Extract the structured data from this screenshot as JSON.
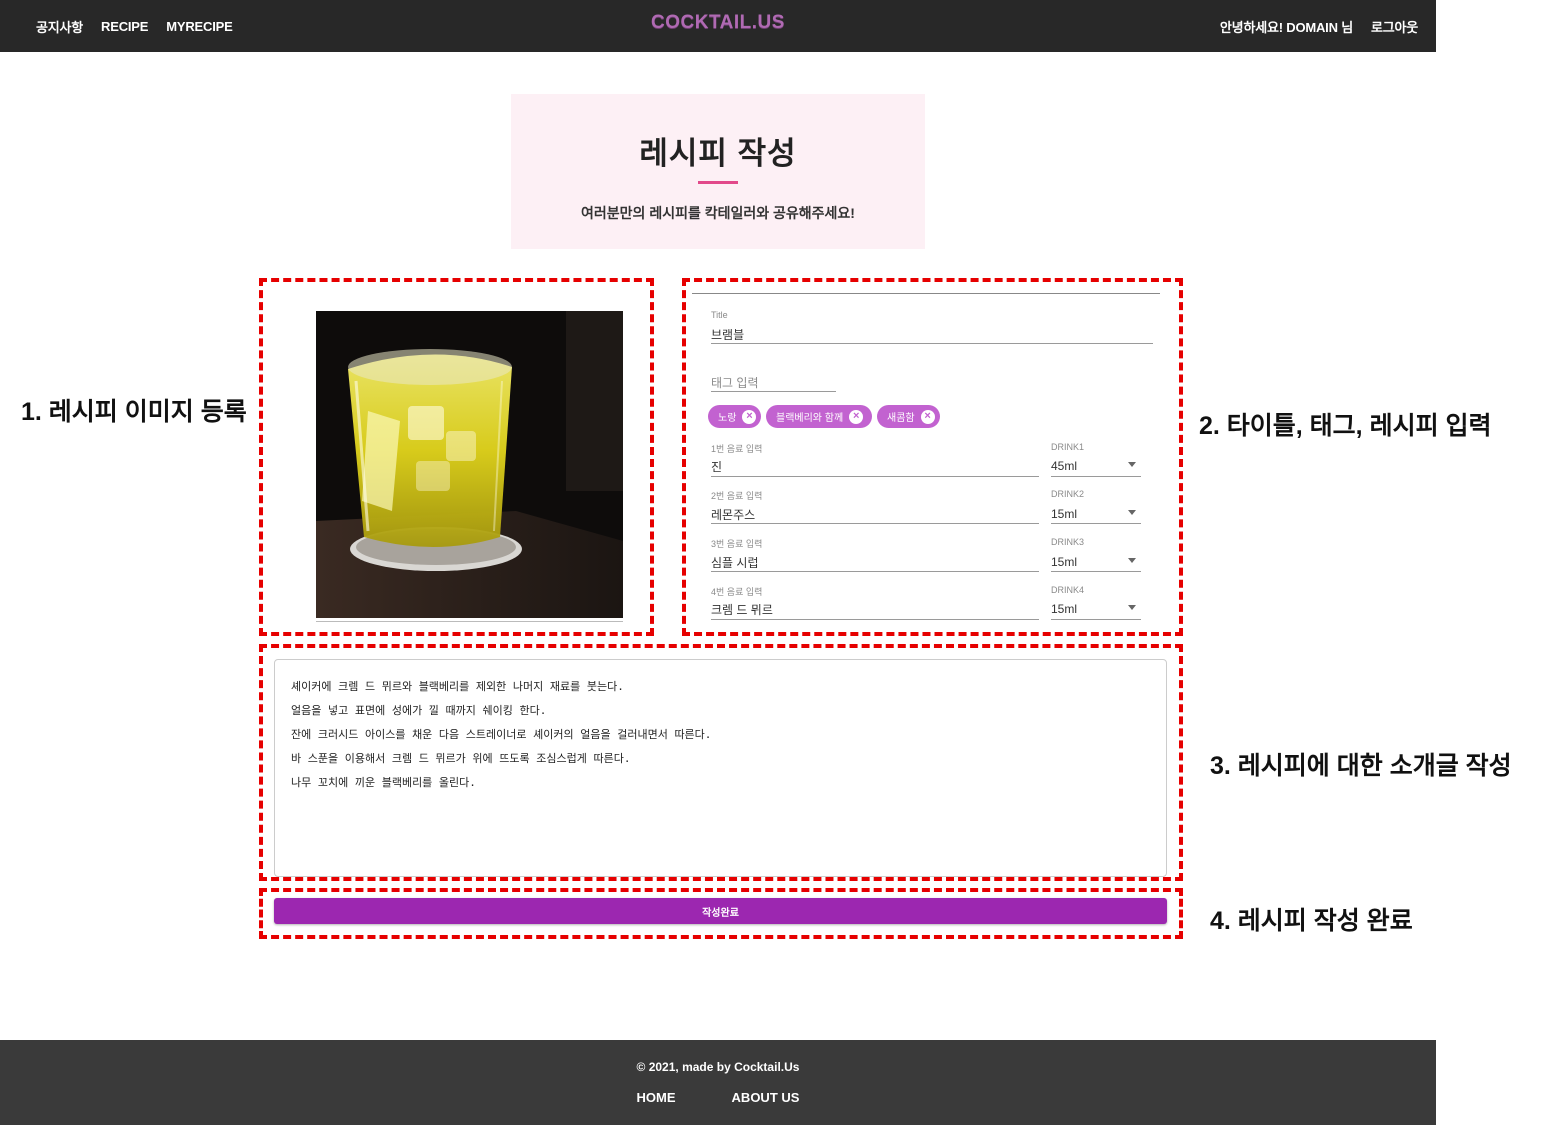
{
  "nav": {
    "notice": "공지사항",
    "recipe": "RECIPE",
    "myrecipe": "MYRECIPE",
    "logo": "COCKTAIL.US",
    "greeting": "안녕하세요! DOMAIN 님",
    "logout": "로그아웃"
  },
  "hero": {
    "title": "레시피 작성",
    "subtitle": "여러분만의 레시피를 칵테일러와 공유해주세요!"
  },
  "annotations": {
    "a1": "1. 레시피 이미지 등록",
    "a2": "2. 타이틀, 태그, 레시피 입력",
    "a3": "3. 레시피에 대한 소개글 작성",
    "a4": "4. 레시피 작성 완료"
  },
  "form": {
    "title_label": "Title",
    "title_value": "브램블",
    "tag_placeholder": "태그 입력",
    "tags": [
      "노랑",
      "블랙베리와 함께",
      "새콤함"
    ],
    "drinks": [
      {
        "name_label": "1번 음료 입력",
        "name_value": "진",
        "amount_label": "DRINK1",
        "amount_value": "45ml"
      },
      {
        "name_label": "2번 음료 입력",
        "name_value": "레몬주스",
        "amount_label": "DRINK2",
        "amount_value": "15ml"
      },
      {
        "name_label": "3번 음료 입력",
        "name_value": "심플 시럽",
        "amount_label": "DRINK3",
        "amount_value": "15ml"
      },
      {
        "name_label": "4번 음료 입력",
        "name_value": "크렘 드 뮈르",
        "amount_label": "DRINK4",
        "amount_value": "15ml"
      }
    ]
  },
  "description": {
    "lines": [
      "셰이커에 크렘 드 뮈르와 블랙베리를 제외한 나머지 재료를 붓는다.",
      "얼음을 넣고 표면에 성에가 낄 때까지 쉐이킹 한다.",
      "잔에 크러시드 아이스를 채운 다음 스트레이너로 셰이커의 얼음을 걸러내면서 따른다.",
      "바 스푼을 이용해서 크렘 드 뮈르가 위에 뜨도록 조심스럽게 따른다.",
      "나무 꼬치에 끼운 블랙베리를 올린다."
    ]
  },
  "submit": {
    "label": "작성완료"
  },
  "footer": {
    "copyright": "© 2021, made by Cocktail.Us",
    "home": "HOME",
    "about": "ABOUT US"
  },
  "colors": {
    "nav_bg": "#282828",
    "logo": "#b06ab3",
    "hero_bg": "#fdf0f5",
    "hero_accent": "#e2498a",
    "chip": "#c262d0",
    "submit": "#9c27b0",
    "annotation_border": "#e60000",
    "footer_bg": "#3a3a3a"
  }
}
